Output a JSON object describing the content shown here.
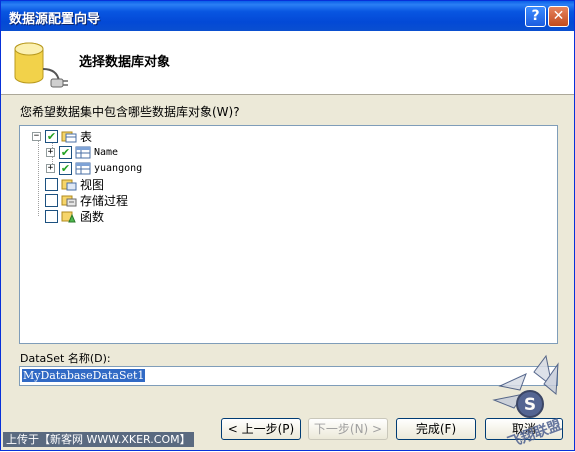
{
  "window": {
    "title": "数据源配置向导"
  },
  "titlebar": {
    "help_label": "?",
    "close_label": "✕"
  },
  "header": {
    "title": "选择数据库对象"
  },
  "prompt": "您希望数据集中包含哪些数据库对象(W)?",
  "tree": {
    "tables": {
      "label": "表",
      "checked": true,
      "expanded": true
    },
    "table_items": [
      {
        "label": "Name",
        "checked": true
      },
      {
        "label": "yuangong",
        "checked": true
      }
    ],
    "views": {
      "label": "视图",
      "checked": false
    },
    "procedures": {
      "label": "存储过程",
      "checked": false
    },
    "functions": {
      "label": "函数",
      "checked": false
    }
  },
  "dataset": {
    "label": "DataSet 名称(D):",
    "value": "MyDatabaseDataSet1"
  },
  "buttons": {
    "prev": "< 上一步(P)",
    "next": "下一步(N) >",
    "finish": "完成(F)",
    "cancel": "取消"
  },
  "watermark": "上传于【新客网 WWW.XKER.COM】",
  "logo_text": "飞翔联盟"
}
